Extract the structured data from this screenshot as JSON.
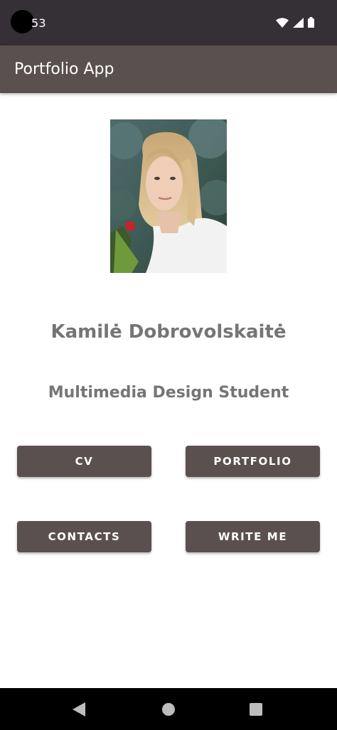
{
  "status_bar": {
    "time": "53",
    "icons": [
      "wifi-icon",
      "cellular-signal-icon",
      "battery-icon"
    ]
  },
  "app_bar": {
    "title": "Portfolio App"
  },
  "profile": {
    "photo": "profile-photo",
    "name": "Kamilė Dobrovolskaitė",
    "role": "Multimedia Design Student"
  },
  "buttons": {
    "cv": "CV",
    "portfolio": "PORTFOLIO",
    "contacts": "CONTACTS",
    "write_me": "WRITE ME"
  },
  "nav_bar": {
    "icons": [
      "back-icon",
      "home-icon",
      "recents-icon"
    ]
  },
  "colors": {
    "status_bar_bg": "#352f36",
    "primary": "#5b5050",
    "text_gray": "#757575",
    "white": "#ffffff"
  }
}
